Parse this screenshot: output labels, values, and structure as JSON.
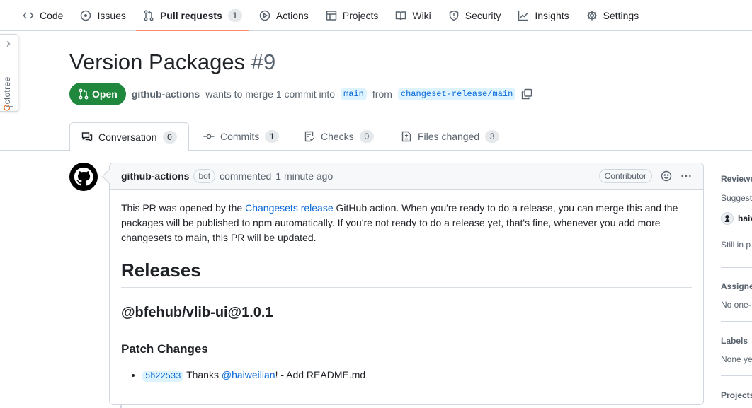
{
  "repo_nav": {
    "items": [
      {
        "label": "Code",
        "icon": "code-icon"
      },
      {
        "label": "Issues",
        "icon": "issue-icon"
      },
      {
        "label": "Pull requests",
        "icon": "pull-request-icon",
        "count": "1",
        "active": true
      },
      {
        "label": "Actions",
        "icon": "play-icon"
      },
      {
        "label": "Projects",
        "icon": "table-icon"
      },
      {
        "label": "Wiki",
        "icon": "book-icon"
      },
      {
        "label": "Security",
        "icon": "shield-icon"
      },
      {
        "label": "Insights",
        "icon": "graph-icon"
      },
      {
        "label": "Settings",
        "icon": "gear-icon"
      }
    ]
  },
  "octotree": {
    "label": "Octotree"
  },
  "pr": {
    "title": "Version Packages",
    "number": "#9",
    "state": "Open",
    "author": "github-actions",
    "merge_text": "wants to merge 1 commit into",
    "base_branch": "main",
    "from_text": "from",
    "head_branch": "changeset-release/main"
  },
  "tabs": [
    {
      "label": "Conversation",
      "count": "0",
      "icon": "comment-discussion-icon",
      "selected": true
    },
    {
      "label": "Commits",
      "count": "1",
      "icon": "commit-icon"
    },
    {
      "label": "Checks",
      "count": "0",
      "icon": "checklist-icon"
    },
    {
      "label": "Files changed",
      "count": "3",
      "icon": "file-diff-icon"
    }
  ],
  "comment": {
    "author": "github-actions",
    "bot_label": "bot",
    "action": "commented",
    "time": "1 minute ago",
    "role": "Contributor",
    "body_pre": "This PR was opened by the ",
    "body_link": "Changesets release",
    "body_post": " GitHub action. When you're ready to do a release, you can merge this and the packages will be published to npm automatically. If you're not ready to do a release yet, that's fine, whenever you add more changesets to main, this PR will be updated.",
    "h1": "Releases",
    "h2": "@bfehub/vlib-ui@1.0.1",
    "h3": "Patch Changes",
    "change": {
      "sha": "5b22533",
      "thanks": "Thanks ",
      "user": "@haiweilian",
      "rest": "! - Add README.md"
    }
  },
  "sidebar": {
    "reviewers_heading": "Reviewe",
    "suggest_text": "Suggest",
    "reviewer_name": "haiv",
    "still_text": "Still in p",
    "assignees_heading": "Assigne",
    "assignees_text": "No one-",
    "labels_heading": "Labels",
    "labels_text": "None ye",
    "projects_heading": "Projects"
  }
}
